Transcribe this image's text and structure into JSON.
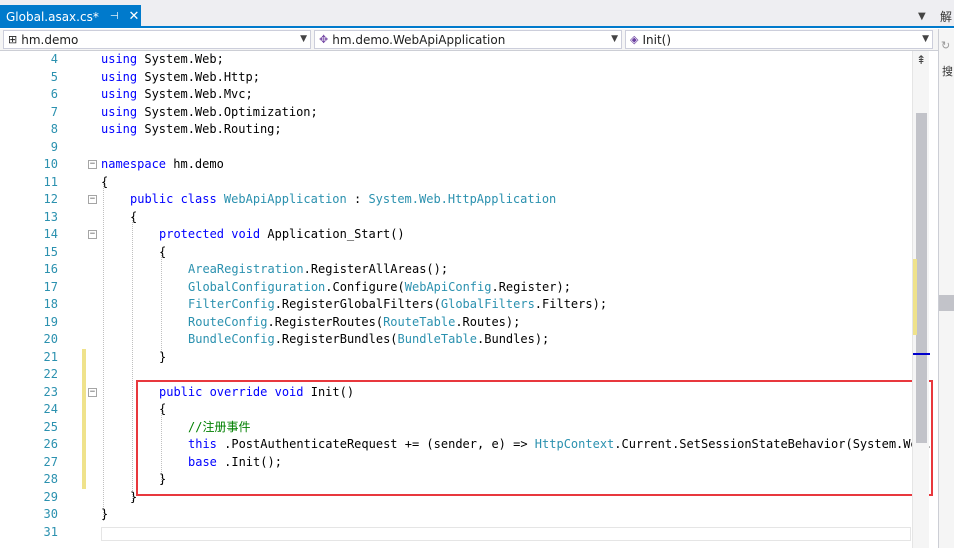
{
  "tab": {
    "title": "Global.asax.cs*",
    "pin": "⊣",
    "close": "✕"
  },
  "side_panel": {
    "title": "解",
    "search_hint": "搜"
  },
  "navbar": {
    "project": "hm.demo",
    "class": "hm.demo.WebApiApplication",
    "member": "Init()"
  },
  "code_lines": [
    {
      "n": "4",
      "tokens": [
        [
          "kw",
          "using"
        ],
        [
          "",
          "System.Web;"
        ]
      ]
    },
    {
      "n": "5",
      "tokens": [
        [
          "kw",
          "using"
        ],
        [
          "",
          "System.Web.Http;"
        ]
      ]
    },
    {
      "n": "6",
      "tokens": [
        [
          "kw",
          "using"
        ],
        [
          "",
          "System.Web.Mvc;"
        ]
      ]
    },
    {
      "n": "7",
      "tokens": [
        [
          "kw",
          "using"
        ],
        [
          "",
          "System.Web.Optimization;"
        ]
      ]
    },
    {
      "n": "8",
      "tokens": [
        [
          "kw",
          "using"
        ],
        [
          "",
          "System.Web.Routing;"
        ]
      ]
    },
    {
      "n": "9",
      "tokens": []
    },
    {
      "n": "10",
      "tokens": [
        [
          "kw",
          "namespace"
        ],
        [
          "",
          "hm.demo"
        ]
      ]
    },
    {
      "n": "11",
      "tokens": [
        [
          "",
          "{"
        ]
      ]
    },
    {
      "n": "12",
      "tokens": [
        [
          "kw",
          "public class"
        ],
        [
          "ty",
          "WebApiApplication"
        ],
        [
          "",
          " : "
        ],
        [
          "ty",
          "System.Web.HttpApplication"
        ]
      ]
    },
    {
      "n": "13",
      "tokens": [
        [
          "",
          "{"
        ]
      ]
    },
    {
      "n": "14",
      "tokens": [
        [
          "kw",
          "protected void"
        ],
        [
          "",
          "Application_Start()"
        ]
      ]
    },
    {
      "n": "15",
      "tokens": [
        [
          "",
          "{"
        ]
      ]
    },
    {
      "n": "16",
      "tokens": [
        [
          "ty",
          "AreaRegistration"
        ],
        [
          "",
          ".RegisterAllAreas();"
        ]
      ]
    },
    {
      "n": "17",
      "tokens": [
        [
          "ty",
          "GlobalConfiguration"
        ],
        [
          "",
          ".Configure("
        ],
        [
          "ty",
          "WebApiConfig"
        ],
        [
          "",
          ".Register);"
        ]
      ]
    },
    {
      "n": "18",
      "tokens": [
        [
          "ty",
          "FilterConfig"
        ],
        [
          "",
          ".RegisterGlobalFilters("
        ],
        [
          "ty",
          "GlobalFilters"
        ],
        [
          "",
          ".Filters);"
        ]
      ]
    },
    {
      "n": "19",
      "tokens": [
        [
          "ty",
          "RouteConfig"
        ],
        [
          "",
          ".RegisterRoutes("
        ],
        [
          "ty",
          "RouteTable"
        ],
        [
          "",
          ".Routes);"
        ]
      ]
    },
    {
      "n": "20",
      "tokens": [
        [
          "ty",
          "BundleConfig"
        ],
        [
          "",
          ".RegisterBundles("
        ],
        [
          "ty",
          "BundleTable"
        ],
        [
          "",
          ".Bundles);"
        ]
      ]
    },
    {
      "n": "21",
      "tokens": [
        [
          "",
          "}"
        ]
      ]
    },
    {
      "n": "22",
      "tokens": []
    },
    {
      "n": "23",
      "tokens": [
        [
          "kw",
          "public override void"
        ],
        [
          "",
          "Init()"
        ]
      ]
    },
    {
      "n": "24",
      "tokens": [
        [
          "",
          "{"
        ]
      ]
    },
    {
      "n": "25",
      "tokens": [
        [
          "cm",
          "//注册事件"
        ]
      ]
    },
    {
      "n": "26",
      "tokens": [
        [
          "kw",
          "this"
        ],
        [
          "",
          ".PostAuthenticateRequest += (sender, e) => "
        ],
        [
          "ty",
          "HttpContext"
        ],
        [
          "",
          ".Current.SetSessionStateBehavior(System.Web."
        ]
      ]
    },
    {
      "n": "27",
      "tokens": [
        [
          "kw",
          "base"
        ],
        [
          "",
          ".Init();"
        ]
      ]
    },
    {
      "n": "28",
      "tokens": [
        [
          "",
          "}"
        ]
      ]
    },
    {
      "n": "29",
      "tokens": [
        [
          "",
          "}"
        ]
      ]
    },
    {
      "n": "30",
      "tokens": [
        [
          "",
          "}"
        ]
      ]
    },
    {
      "n": "31",
      "tokens": []
    }
  ]
}
